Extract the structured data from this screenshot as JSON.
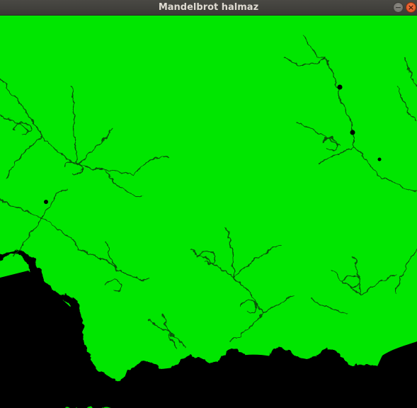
{
  "window": {
    "title": "Mandelbrot halmaz",
    "minimize_symbol": "−",
    "close_symbol": "×"
  },
  "colors": {
    "escape_fill": "#00e600",
    "set_fill": "#000000",
    "filament": "#0b4a0b",
    "titlebar": "#3c3b37"
  },
  "icons": {
    "minimize": "minimize-icon",
    "close": "close-icon"
  }
}
